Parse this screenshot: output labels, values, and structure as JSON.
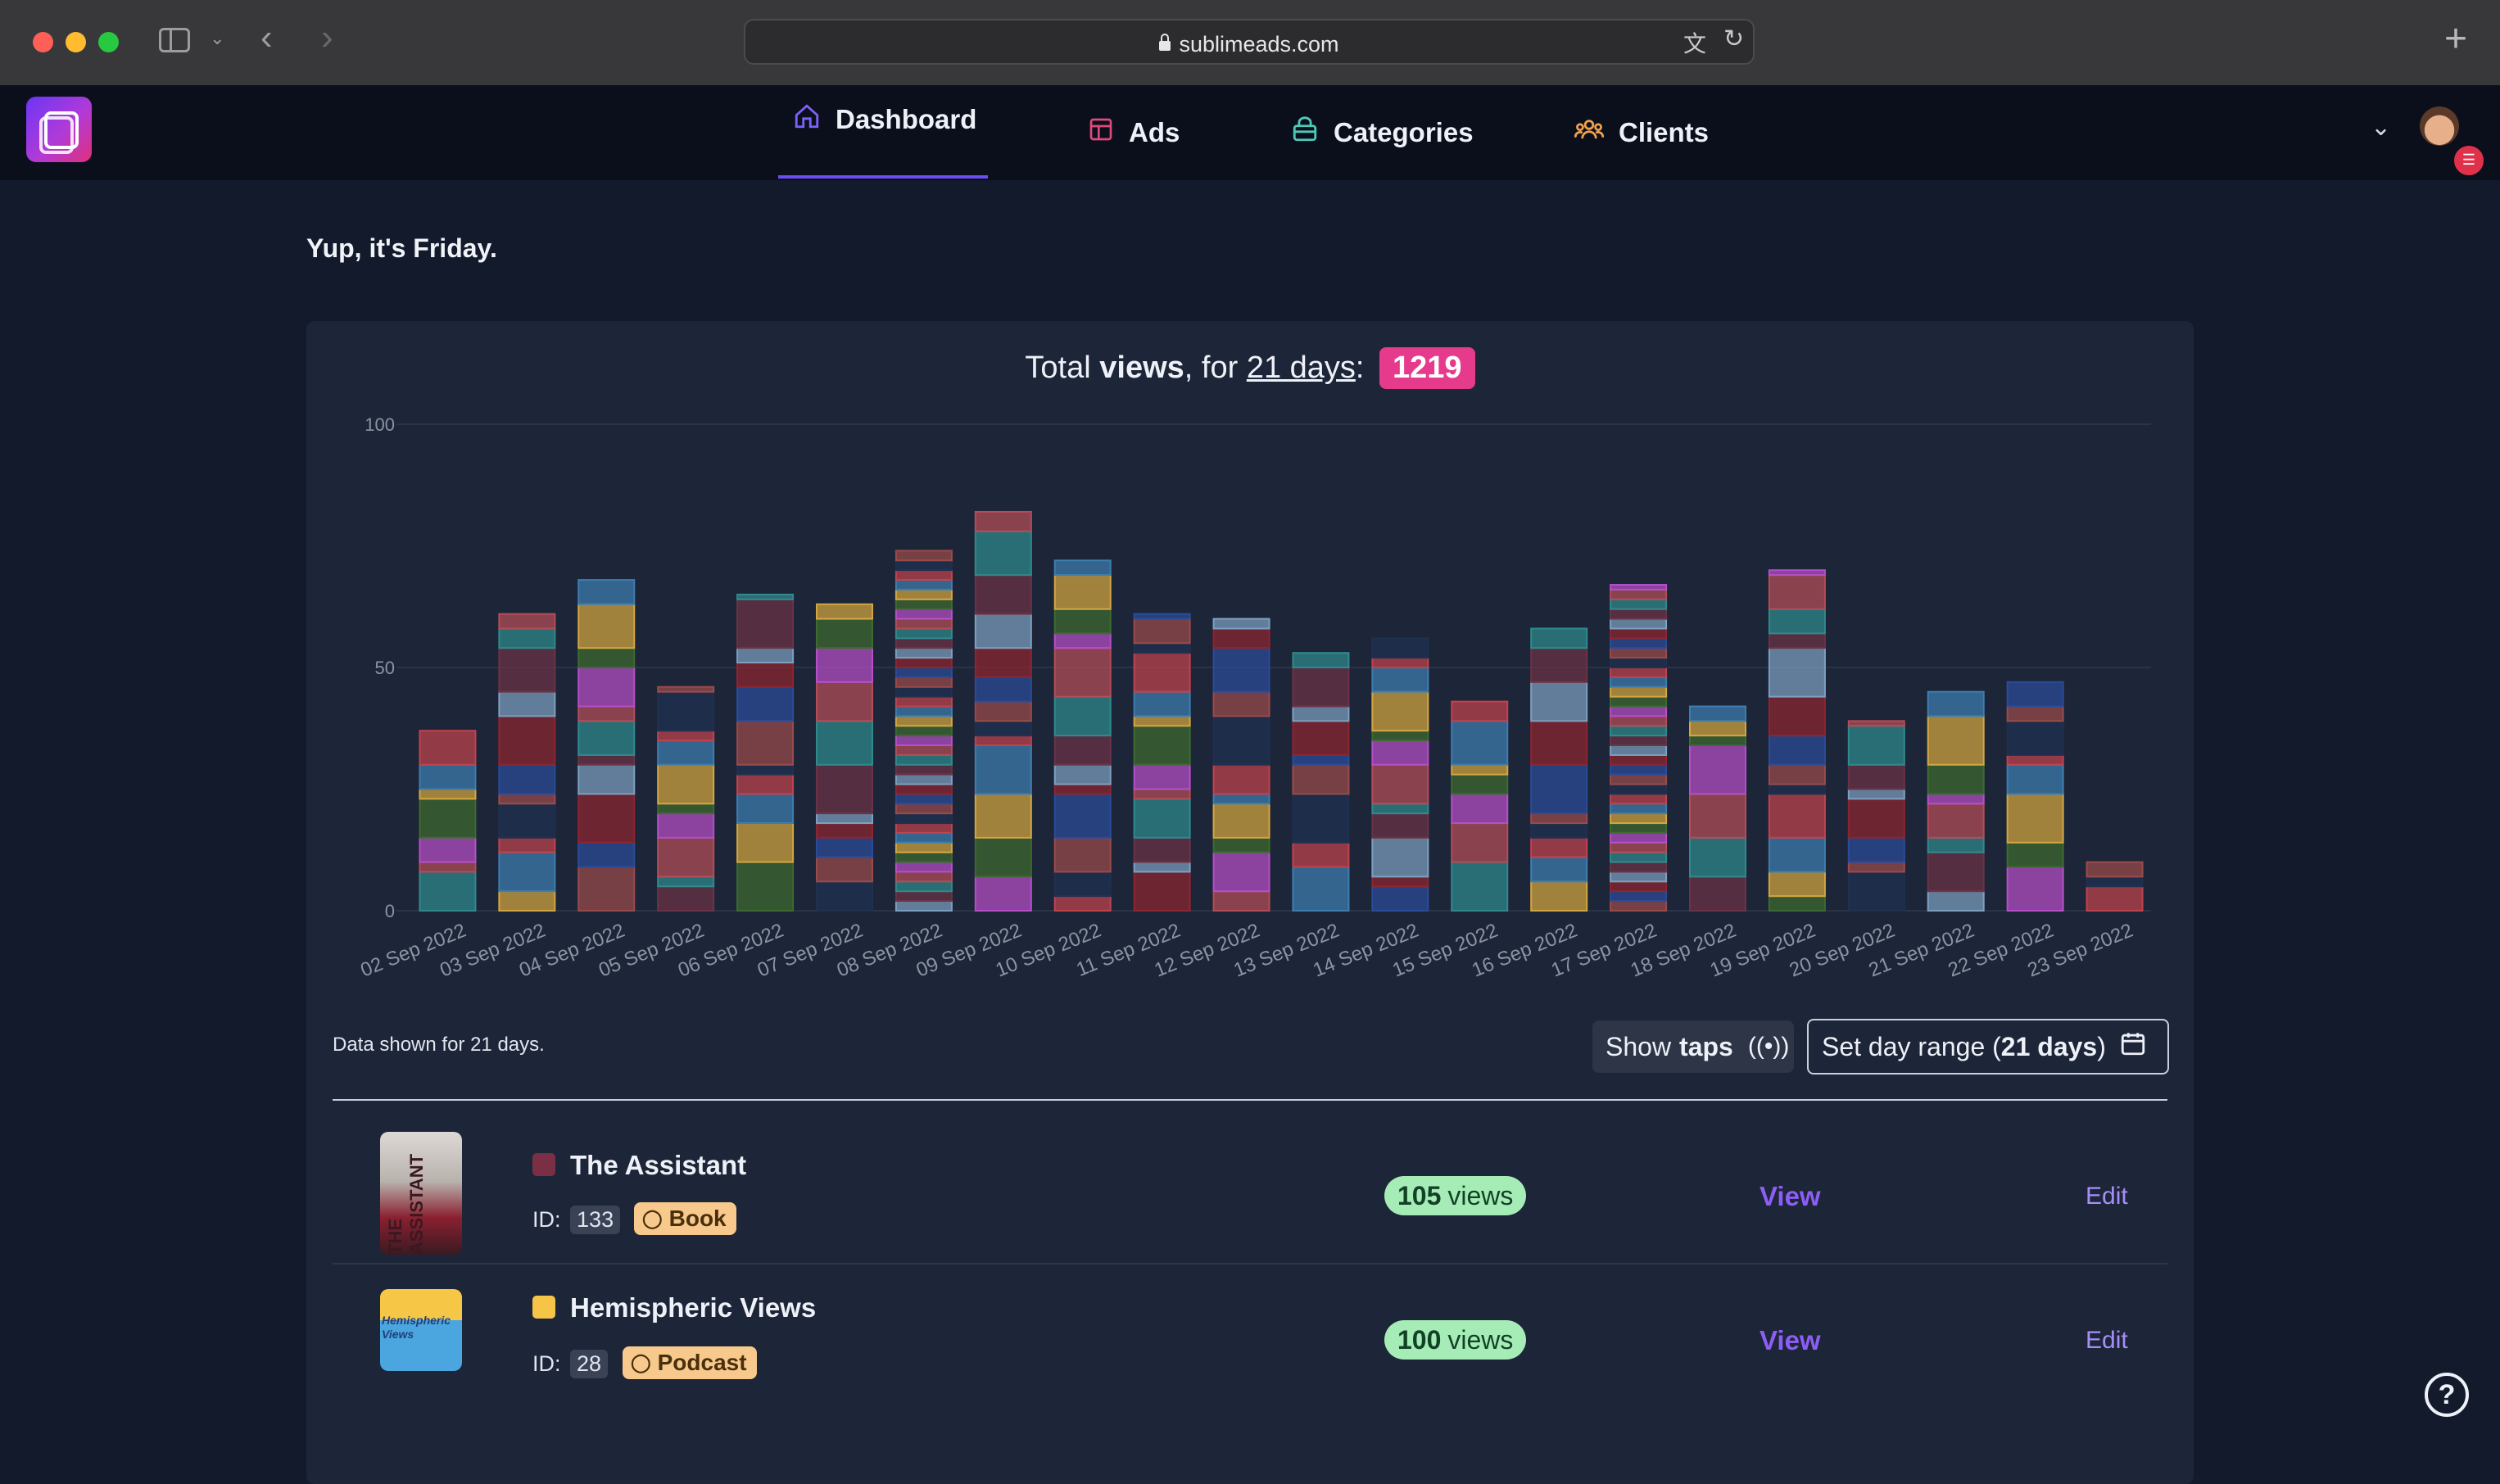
{
  "browser": {
    "url": "sublimeads.com"
  },
  "nav": {
    "tabs": [
      {
        "label": "Dashboard",
        "icon": "home-icon"
      },
      {
        "label": "Ads",
        "icon": "layout-icon"
      },
      {
        "label": "Categories",
        "icon": "basket-icon"
      },
      {
        "label": "Clients",
        "icon": "users-icon"
      }
    ],
    "active_tab": "Dashboard"
  },
  "greeting": "Yup, it's Friday.",
  "summary": {
    "prefix": "Total ",
    "metric": "views",
    "middle": ", for ",
    "range_link": "21 days",
    "colon": ":",
    "total": "1219"
  },
  "chart_data": {
    "type": "bar",
    "stacked": true,
    "ylim": [
      0,
      100
    ],
    "yticks": [
      "0",
      "50",
      "100"
    ],
    "grid": true,
    "categories": [
      "02 Sep 2022",
      "03 Sep 2022",
      "04 Sep 2022",
      "05 Sep 2022",
      "06 Sep 2022",
      "07 Sep 2022",
      "08 Sep 2022",
      "09 Sep 2022",
      "10 Sep 2022",
      "11 Sep 2022",
      "12 Sep 2022",
      "13 Sep 2022",
      "14 Sep 2022",
      "15 Sep 2022",
      "16 Sep 2022",
      "17 Sep 2022",
      "18 Sep 2022",
      "19 Sep 2022",
      "20 Sep 2022",
      "21 Sep 2022",
      "22 Sep 2022",
      "23 Sep 2022"
    ],
    "totals": [
      37,
      61,
      68,
      46,
      65,
      63,
      74,
      82,
      72,
      61,
      60,
      53,
      56,
      43,
      58,
      67,
      42,
      70,
      39,
      45,
      47,
      10
    ],
    "palette": [
      "#b64fc8",
      "#8e2530",
      "#3d7eb0",
      "#2f8a8e",
      "#9a4b4b",
      "#3d6b30",
      "#7da0c0",
      "#c0434e",
      "#b44d57",
      "#2b4c9a",
      "#d4a640",
      "#6b3345",
      "#1f3050"
    ]
  },
  "footer": {
    "note": "Data shown for 21 days.",
    "taps_button_prefix": "Show ",
    "taps_button_bold": "taps",
    "range_button_prefix": "Set day range (",
    "range_button_bold": "21 days",
    "range_button_suffix": ")"
  },
  "items": [
    {
      "title": "The Assistant",
      "id_label": "ID:",
      "id": "133",
      "tag": "Book",
      "views_count": "105",
      "views_label": "views",
      "view_link": "View",
      "edit_link": "Edit",
      "color": "#7a2f45",
      "cover_text": "THE ASSISTANT"
    },
    {
      "title": "Hemispheric Views",
      "id_label": "ID:",
      "id": "28",
      "tag": "Podcast",
      "views_count": "100",
      "views_label": "views",
      "view_link": "View",
      "edit_link": "Edit",
      "color": "#f6c447",
      "cover_text": "Hemispheric Views"
    }
  ]
}
